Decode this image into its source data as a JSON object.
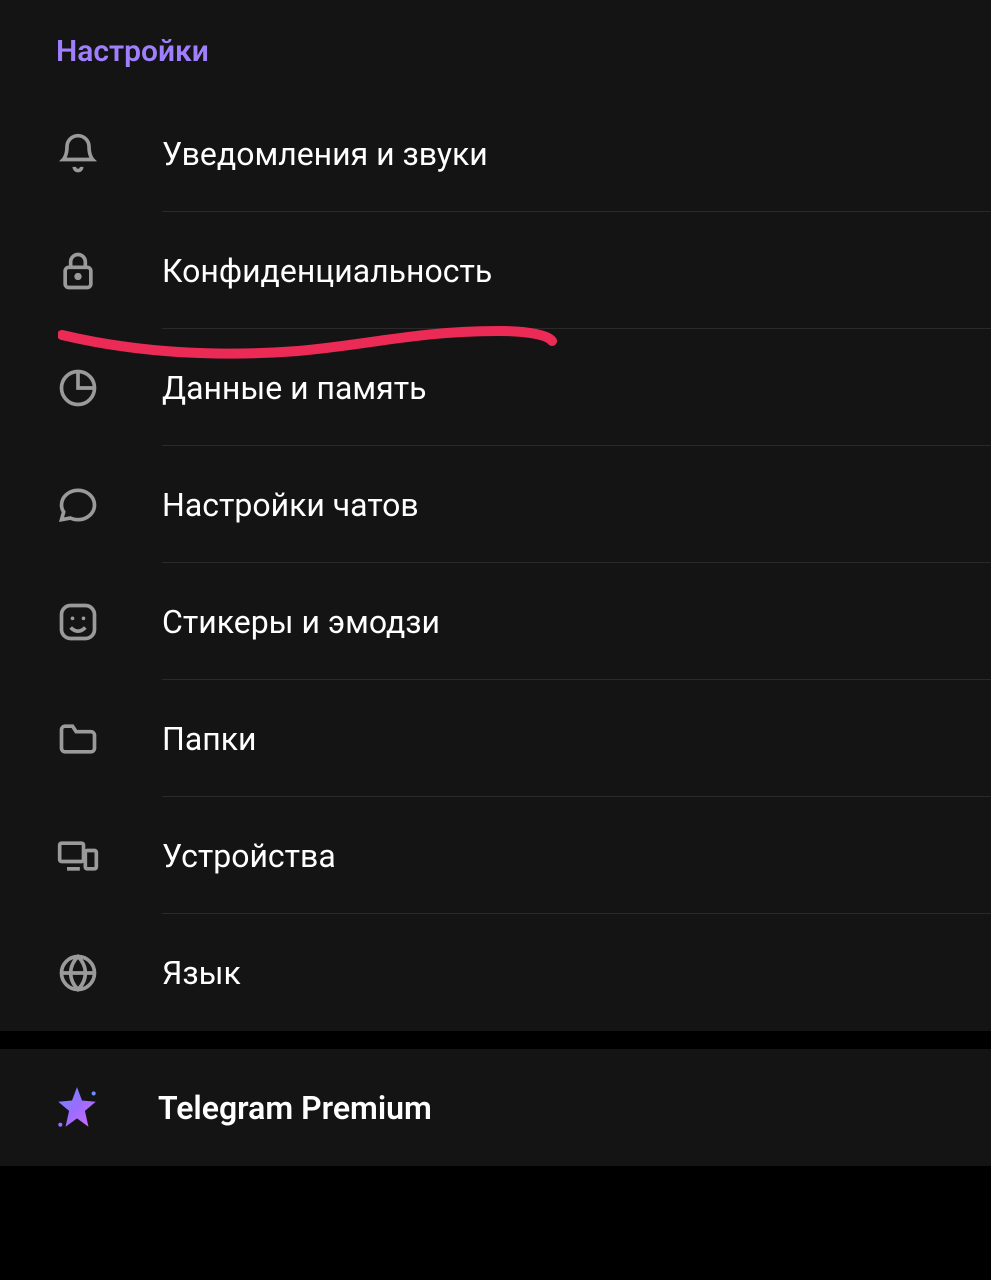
{
  "settings": {
    "header": "Настройки",
    "items": [
      {
        "icon": "bell-icon",
        "label": "Уведомления и звуки"
      },
      {
        "icon": "lock-icon",
        "label": "Конфиденциальность"
      },
      {
        "icon": "pie-icon",
        "label": "Данные и память"
      },
      {
        "icon": "chat-icon",
        "label": "Настройки чатов"
      },
      {
        "icon": "sticker-icon",
        "label": "Стикеры и эмодзи"
      },
      {
        "icon": "folder-icon",
        "label": "Папки"
      },
      {
        "icon": "devices-icon",
        "label": "Устройства"
      },
      {
        "icon": "globe-icon",
        "label": "Язык"
      }
    ]
  },
  "premium": {
    "label": "Telegram Premium"
  }
}
